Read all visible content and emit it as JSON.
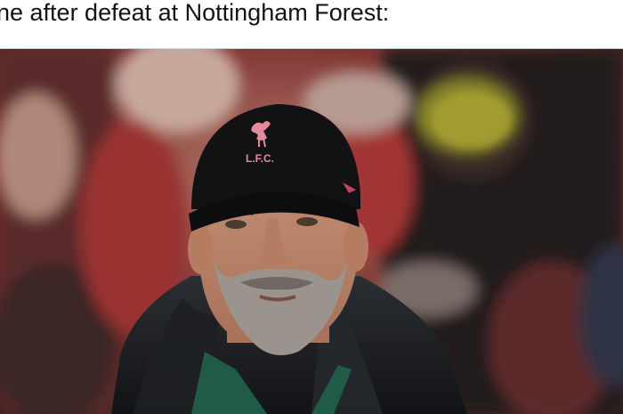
{
  "tweet": {
    "text": "ne after defeat at Nottingham Forest:"
  },
  "photo": {
    "cap_crest_text": "L.F.C.",
    "colors": {
      "crowd_red": "#8c2a2a",
      "crowd_dark": "#2b2523",
      "cap_black": "#121215",
      "crest_pink": "#e58a9e",
      "jacket_black": "#1b1d21",
      "collar_green": "#1f5b46",
      "skin": "#c58f73",
      "beard_grey": "#9b948e",
      "yellow_print": "#c7c23a"
    }
  }
}
